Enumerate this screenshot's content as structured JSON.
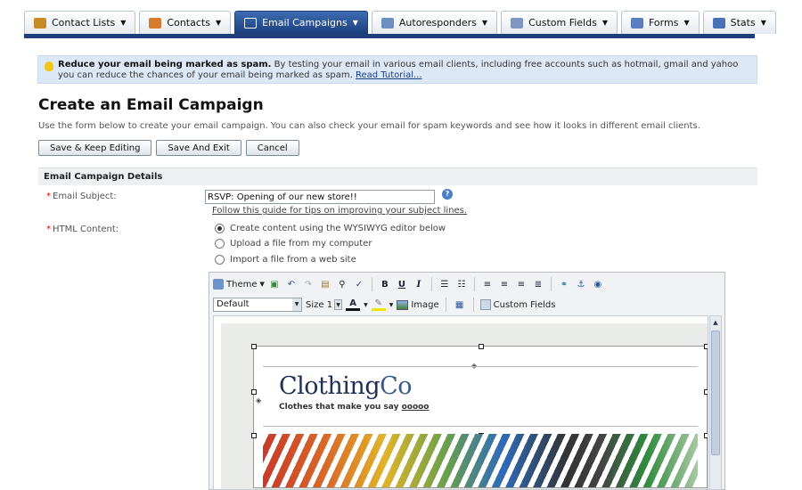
{
  "tabs": [
    {
      "label": "Contact Lists",
      "icon": "contact-lists-icon",
      "color": "#c98a2a",
      "active": false
    },
    {
      "label": "Contacts",
      "icon": "contacts-icon",
      "color": "#d77b2e",
      "active": false
    },
    {
      "label": "Email Campaigns",
      "icon": "envelope-icon",
      "color": "#ffffff",
      "active": true
    },
    {
      "label": "Autoresponders",
      "icon": "autoresponder-icon",
      "color": "#6c8fbf",
      "active": false
    },
    {
      "label": "Custom Fields",
      "icon": "custom-fields-icon",
      "color": "#7f98c2",
      "active": false
    },
    {
      "label": "Forms",
      "icon": "forms-icon",
      "color": "#5a7fc0",
      "active": false
    },
    {
      "label": "Stats",
      "icon": "stats-icon",
      "color": "#4a70b8",
      "active": false
    }
  ],
  "tip": {
    "bold": "Reduce your email being marked as spam.",
    "text": " By testing your email in various email clients, including free accounts such as hotmail, gmail and yahoo you can reduce the chances of your email being marked as spam. ",
    "link": "Read Tutorial..."
  },
  "page": {
    "title": "Create an Email Campaign",
    "description": "Use the form below to create your email campaign. You can also check your email for spam keywords and see how it looks in different email clients."
  },
  "buttons": {
    "save_keep": "Save & Keep Editing",
    "save_exit": "Save And Exit",
    "cancel": "Cancel"
  },
  "section": {
    "title": "Email Campaign Details"
  },
  "form": {
    "subject_label": "Email Subject:",
    "subject_value": "RSVP: Opening of our new store!!",
    "subject_help": "Follow this guide for tips on improving your subject lines.",
    "html_label": "HTML Content:",
    "required_mark": "*",
    "options": [
      {
        "label": "Create content using the WYSIWYG editor below",
        "selected": true
      },
      {
        "label": "Upload a file from my computer",
        "selected": false
      },
      {
        "label": "Import a file from a web site",
        "selected": false
      }
    ]
  },
  "editor": {
    "theme_label": "Theme",
    "font_value": "Default",
    "size_label": "Size 1",
    "image_label": "Image",
    "custom_fields_label": "Custom Fields",
    "brand_main": "Clothing",
    "brand_suffix": "Co",
    "tagline_prefix": "Clothes that make you say ",
    "tagline_link": "ooooo"
  }
}
